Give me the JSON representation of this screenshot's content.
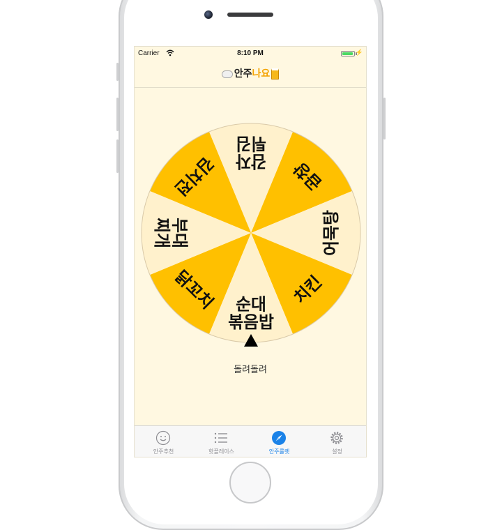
{
  "status_bar": {
    "carrier": "Carrier",
    "time": "8:10 PM"
  },
  "nav": {
    "title_main": "안주",
    "title_accent": "나요",
    "accent_color": "#f4a300"
  },
  "wheel": {
    "colors": {
      "light": "#fff1cc",
      "dark": "#ffc000",
      "rim": "#d9c9a8"
    },
    "segments": [
      {
        "label": "순대\n볶음밥",
        "style": "light"
      },
      {
        "label": "닭꼬치",
        "style": "dark"
      },
      {
        "label": "부대\n찌개",
        "style": "light"
      },
      {
        "label": "김치전",
        "style": "dark"
      },
      {
        "label": "감자\n튀김",
        "style": "light"
      },
      {
        "label": "곱창",
        "style": "dark"
      },
      {
        "label": "어묵탕",
        "style": "light"
      },
      {
        "label": "치킨",
        "style": "dark"
      }
    ]
  },
  "spin_button": "돌려돌려",
  "tabs": [
    {
      "label": "안주추천",
      "icon": "smiley-icon",
      "active": false
    },
    {
      "label": "핫플레이스",
      "icon": "list-icon",
      "active": false
    },
    {
      "label": "안주룰렛",
      "icon": "compass-icon",
      "active": true
    },
    {
      "label": "설정",
      "icon": "gear-icon",
      "active": false
    }
  ],
  "active_color": "#1a82e8"
}
